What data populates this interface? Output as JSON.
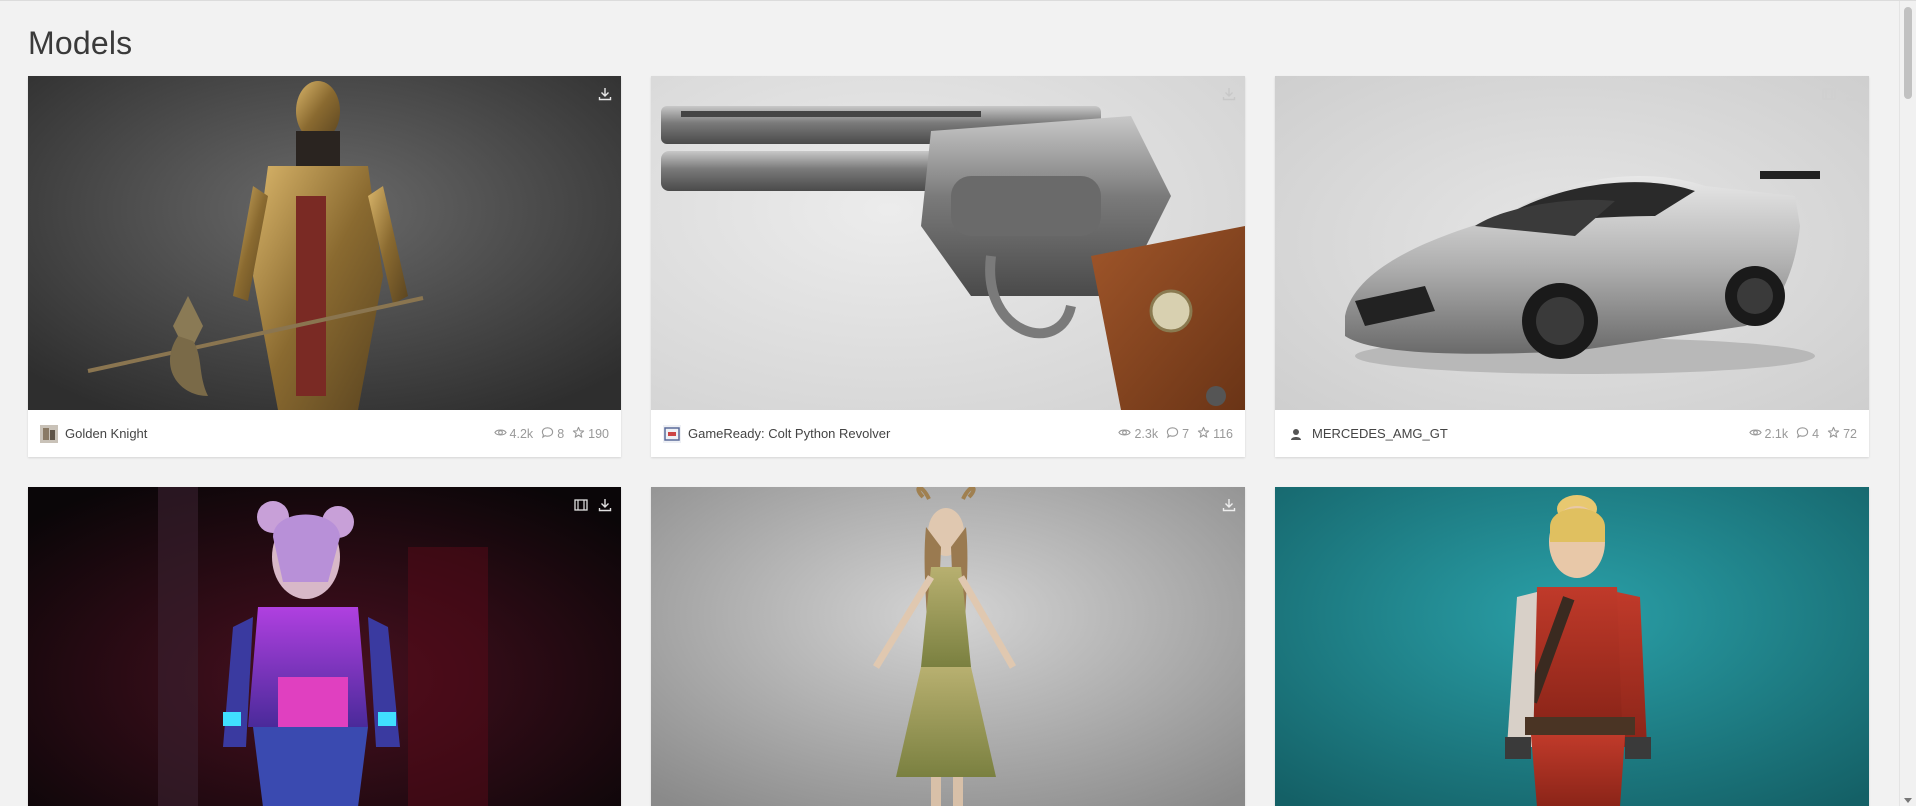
{
  "page": {
    "section_title": "Models"
  },
  "cards": [
    {
      "name": "Golden Knight",
      "views": "4.2k",
      "comments": "8",
      "likes": "190",
      "thumb_icons": [
        "download-icon"
      ]
    },
    {
      "name": "GameReady: Colt Python Revolver",
      "views": "2.3k",
      "comments": "7",
      "likes": "116",
      "thumb_icons": [
        "download-icon"
      ]
    },
    {
      "name": "MERCEDES_AMG_GT",
      "views": "2.1k",
      "comments": "4",
      "likes": "72",
      "thumb_icons": [
        "animation-icon",
        "download-icon"
      ]
    },
    {
      "name": "",
      "thumb_icons": [
        "animation-icon",
        "download-icon"
      ]
    },
    {
      "name": "",
      "thumb_icons": [
        "download-icon"
      ]
    },
    {
      "name": "",
      "thumb_icons": []
    }
  ],
  "colors": {
    "page_background": "#f2f2f2",
    "card_background": "#ffffff",
    "stat_gray": "#999999",
    "title_text": "#3a3a3a"
  }
}
